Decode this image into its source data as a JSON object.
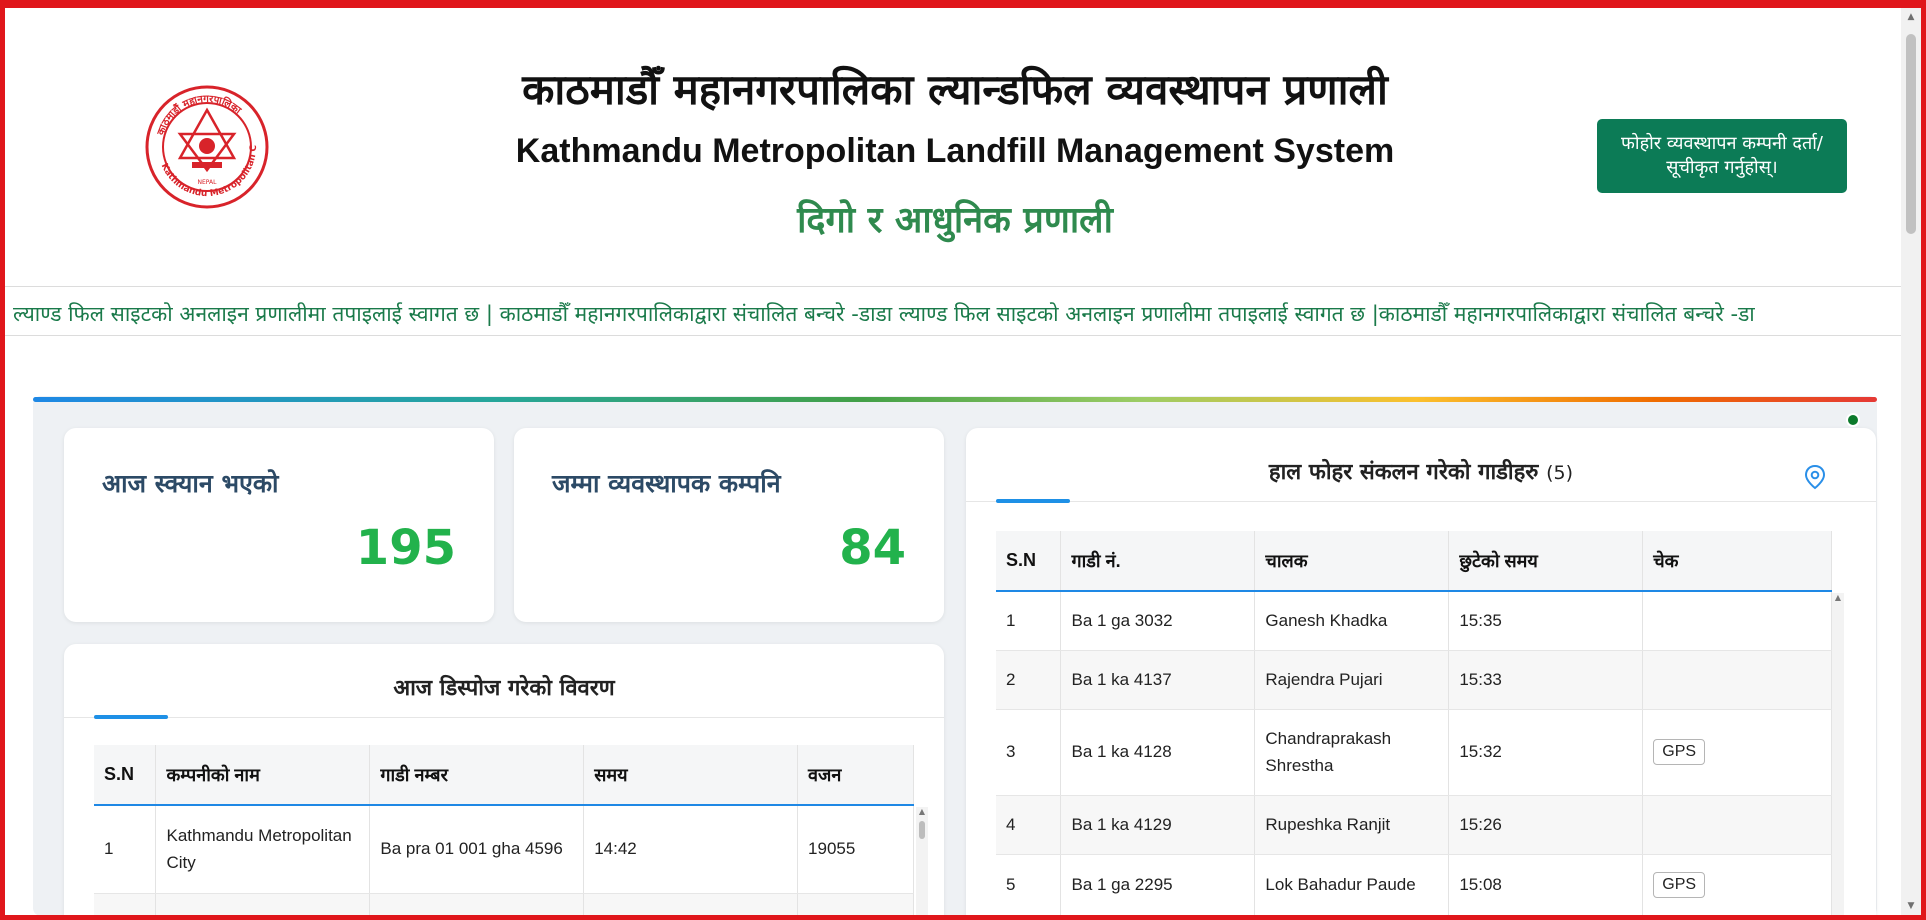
{
  "header": {
    "title_np": "काठमाडौँ महानगरपालिका ल्यान्डफिल व्यवस्थापन प्रणाली",
    "title_en": "Kathmandu Metropolitan Landfill Management System",
    "subtitle": "दिगो र आधुनिक प्रणाली",
    "register_button": "फोहोर व्यवस्थापन कम्पनी दर्ता/सूचीकृत गर्नुहोस्।",
    "logo": {
      "ring_text": "काठमाडौं महानगरपालिका",
      "bottom_text": "Kathmandu Metropolitan City",
      "inner_text": "NEPAL"
    }
  },
  "ticker": {
    "text": "ल्याण्ड फिल साइटको अनलाइन प्रणालीमा तपाइलाई स्वागत छ | काठमाडौँ महानगरपालिकाद्वारा संचालित बन्चरे -डाडा ल्याण्ड फिल साइटको अनलाइन प्रणालीमा तपाइलाई स्वागत छ |काठमाडौँ महानगरपालिकाद्वारा संचालित बन्चरे -डा"
  },
  "stats": {
    "scanned_label": "आज स्क्यान भएको",
    "scanned_value": "195",
    "companies_label": "जम्मा व्यवस्थापक कम्पनि",
    "companies_value": "84"
  },
  "disposal": {
    "title": "आज डिस्पोज गरेको विवरण",
    "columns": [
      "S.N",
      "कम्पनीको नाम",
      "गाडी नम्बर",
      "समय",
      "वजन"
    ],
    "rows": [
      {
        "sn": "1",
        "company": "Kathmandu Metropolitan City",
        "vehicle": "Ba pra 01 001 gha 4596",
        "time": "14:42",
        "weight": "19055"
      }
    ]
  },
  "vehicles": {
    "title": "हाल फोहर संकलन गरेको गाडीहरु",
    "count": "(5)",
    "columns": [
      "S.N",
      "गाडी नं.",
      "चालक",
      "छुटेको समय",
      "चेक"
    ],
    "rows": [
      {
        "sn": "1",
        "vehicle": "Ba 1 ga 3032",
        "driver": "Ganesh Khadka",
        "time": "15:35",
        "check": ""
      },
      {
        "sn": "2",
        "vehicle": "Ba 1 ka 4137",
        "driver": "Rajendra Pujari",
        "time": "15:33",
        "check": ""
      },
      {
        "sn": "3",
        "vehicle": "Ba 1 ka 4128",
        "driver": "Chandraprakash Shrestha",
        "time": "15:32",
        "check": "GPS"
      },
      {
        "sn": "4",
        "vehicle": "Ba 1 ka 4129",
        "driver": "Rupeshka Ranjit",
        "time": "15:26",
        "check": ""
      },
      {
        "sn": "5",
        "vehicle": "Ba 1 ga 2295",
        "driver": "Lok Bahadur Paude",
        "time": "15:08",
        "check": "GPS"
      }
    ]
  },
  "colors": {
    "brand_green": "#0c7b56",
    "subtitle_green": "#2f8a4e",
    "stat_green": "#22b24c",
    "accent_blue": "#1e88e5",
    "frame_red": "#e0161b"
  }
}
